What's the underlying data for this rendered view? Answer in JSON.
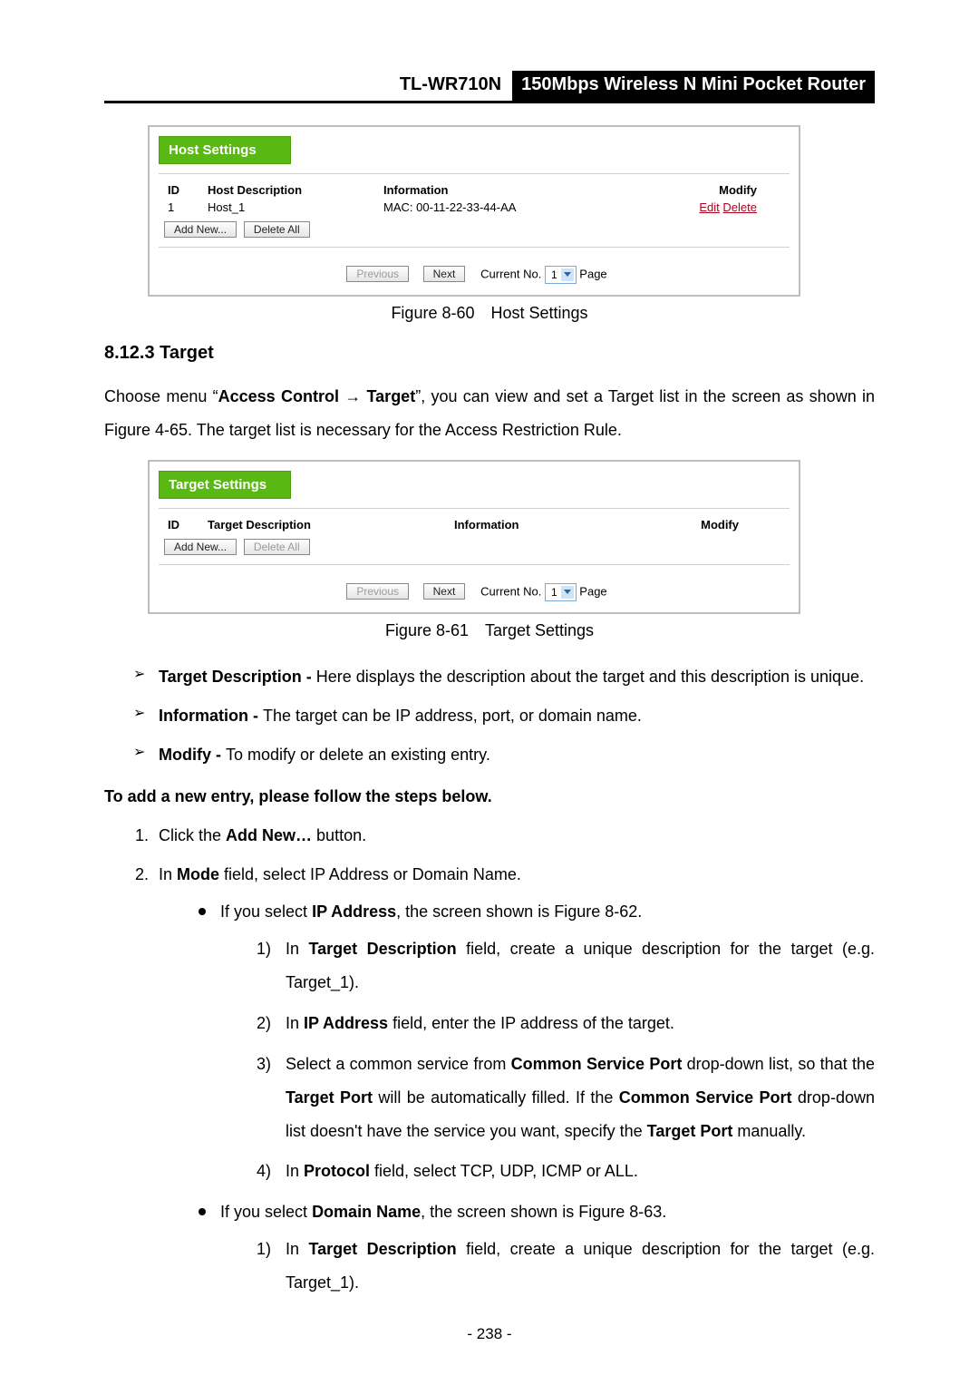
{
  "header": {
    "model": "TL-WR710N",
    "tagline": "150Mbps Wireless N Mini Pocket Router"
  },
  "fig1": {
    "title": "Host Settings",
    "cols": {
      "id": "ID",
      "desc": "Host Description",
      "info": "Information",
      "mod": "Modify"
    },
    "row": {
      "id": "1",
      "desc": "Host_1",
      "info": "MAC: 00-11-22-33-44-AA",
      "edit": "Edit",
      "del": "Delete"
    },
    "addnew": "Add New...",
    "delall": "Delete All",
    "pag": {
      "prev": "Previous",
      "next": "Next",
      "curno": "Current No.",
      "page": "Page",
      "sel": "1"
    },
    "caption": "Figure 8-60 Host Settings"
  },
  "section": {
    "num": "8.12.3 Target"
  },
  "intro": {
    "pre": "Choose menu “",
    "ac": "Access Control",
    "arrow": " → ",
    "tg": "Target",
    "post": "”, you can view and set a Target list in the screen as shown in Figure 4-65. The target list is necessary for the Access Restriction Rule."
  },
  "fig2": {
    "title": "Target Settings",
    "cols": {
      "id": "ID",
      "desc": "Target Description",
      "info": "Information",
      "mod": "Modify"
    },
    "addnew": "Add New...",
    "delall": "Delete All",
    "pag": {
      "prev": "Previous",
      "next": "Next",
      "curno": "Current No.",
      "page": "Page",
      "sel": "1"
    },
    "caption": "Figure 8-61 Target Settings"
  },
  "defs": {
    "d1a": "Target Description - ",
    "d1b": "Here displays the description about the target and this description is unique.",
    "d2a": "Information - ",
    "d2b": "The target can be IP address, port, or domain name.",
    "d3a": "Modify - ",
    "d3b": "To modify or delete an existing entry."
  },
  "steps": {
    "heading": "To add a new entry, please follow the steps below.",
    "s1a": "Click the ",
    "s1b": "Add New…",
    "s1c": " button.",
    "s2a": "In ",
    "s2b": "Mode",
    "s2c": " field, select IP Address or Domain Name.",
    "ip_a": "If you select ",
    "ip_b": "IP Address",
    "ip_c": ", the screen shown is Figure 8-62.",
    "ip1a": "In ",
    "ip1b": "Target Description",
    "ip1c": " field, create a unique description for the target (e.g. Target_1).",
    "ip2a": "In ",
    "ip2b": "IP Address",
    "ip2c": " field, enter the IP address of the target.",
    "ip3a": "Select a common service from ",
    "ip3b": "Common Service Port",
    "ip3c": " drop-down list, so that the ",
    "ip3d": "Target Port",
    "ip3e": " will be automatically filled. If the ",
    "ip3f": "Common Service Port",
    "ip3g": " drop-down list doesn't have the service you want, specify the ",
    "ip3h": "Target Port",
    "ip3i": " manually.",
    "ip4a": "In ",
    "ip4b": "Protocol",
    "ip4c": " field, select TCP, UDP, ICMP or ALL.",
    "dn_a": "If you select ",
    "dn_b": "Domain Name",
    "dn_c": ", the screen shown is Figure 8-63.",
    "dn1a": "In ",
    "dn1b": "Target Description",
    "dn1c": " field, create a unique description for the target (e.g. Target_1)."
  },
  "footer": "- 238 -"
}
